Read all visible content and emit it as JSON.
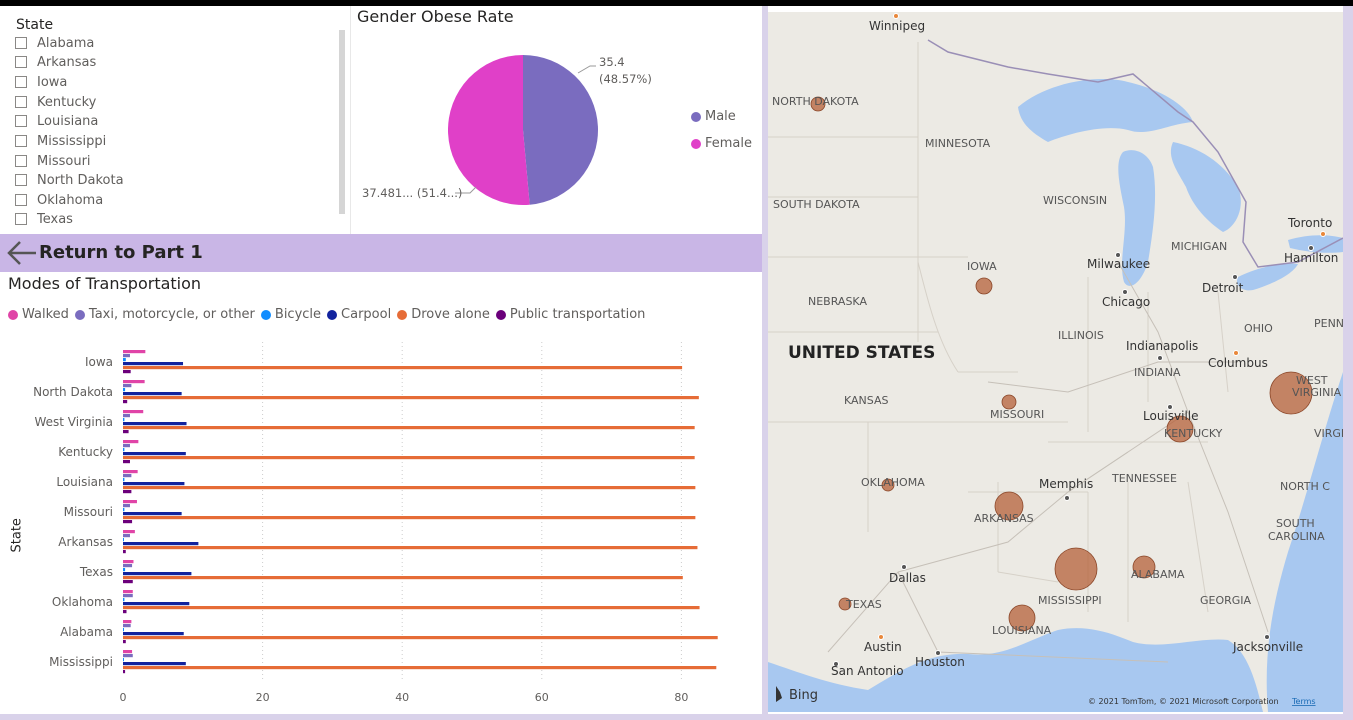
{
  "slicer": {
    "title": "State",
    "items": [
      "Alabama",
      "Arkansas",
      "Iowa",
      "Kentucky",
      "Louisiana",
      "Mississippi",
      "Missouri",
      "North Dakota",
      "Oklahoma",
      "Texas"
    ]
  },
  "pie": {
    "title": "Gender Obese Rate",
    "male_label_value": "35.4",
    "male_label_pct": "(48.57%)",
    "female_label": "37.481... (51.4...)",
    "legend": [
      {
        "name": "Male",
        "color": "#7a6cbf"
      },
      {
        "name": "Female",
        "color": "#e040c8"
      }
    ],
    "chart_data": {
      "type": "pie",
      "slices": [
        {
          "name": "Male",
          "value": 35.4,
          "pct": 48.57
        },
        {
          "name": "Female",
          "value": 37.481,
          "pct": 51.43
        }
      ]
    }
  },
  "banner": {
    "label": "Return to Part 1",
    "icon": "arrow-left-icon"
  },
  "transport": {
    "title": "Modes of Transportation",
    "ylabel": "State",
    "legend": [
      {
        "name": "Walked",
        "color": "#e044a7"
      },
      {
        "name": "Taxi, motorcycle, or other",
        "color": "#7a6cbf"
      },
      {
        "name": "Bicycle",
        "color": "#118dff"
      },
      {
        "name": "Carpool",
        "color": "#12239e"
      },
      {
        "name": "Drove alone",
        "color": "#e66c37"
      },
      {
        "name": "Public transportation",
        "color": "#6b007b"
      }
    ],
    "chart_data": {
      "type": "bar",
      "orientation": "horizontal",
      "categories": [
        "Iowa",
        "North Dakota",
        "West Virginia",
        "Kentucky",
        "Louisiana",
        "Missouri",
        "Arkansas",
        "Texas",
        "Oklahoma",
        "Alabama",
        "Mississippi"
      ],
      "xlim": [
        0,
        88
      ],
      "xticks": [
        0,
        20,
        40,
        60,
        80
      ],
      "series": [
        {
          "name": "Walked",
          "values": [
            3.2,
            3.1,
            2.9,
            2.2,
            2.1,
            2.0,
            1.7,
            1.5,
            1.4,
            1.2,
            1.3
          ]
        },
        {
          "name": "Taxi, motorcycle, or other",
          "values": [
            1.0,
            1.2,
            1.0,
            1.0,
            1.2,
            1.0,
            1.0,
            1.3,
            1.4,
            1.1,
            1.4
          ]
        },
        {
          "name": "Bicycle",
          "values": [
            0.4,
            0.3,
            0.2,
            0.2,
            0.2,
            0.2,
            0.1,
            0.3,
            0.2,
            0.1,
            0.1
          ]
        },
        {
          "name": "Carpool",
          "values": [
            8.6,
            8.4,
            9.1,
            9.0,
            8.8,
            8.4,
            10.8,
            9.8,
            9.5,
            8.7,
            9.0
          ]
        },
        {
          "name": "Drove alone",
          "values": [
            80.1,
            82.5,
            81.9,
            81.9,
            82.0,
            82.0,
            82.3,
            80.2,
            82.6,
            85.2,
            85.0
          ]
        },
        {
          "name": "Public transportation",
          "values": [
            1.1,
            0.6,
            0.8,
            1.0,
            1.2,
            1.3,
            0.4,
            1.4,
            0.5,
            0.4,
            0.3
          ]
        }
      ]
    }
  },
  "map": {
    "country_label": "UNITED STATES",
    "states": [
      {
        "name": "NORTH DAKOTA"
      },
      {
        "name": "MINNESOTA"
      },
      {
        "name": "SOUTH DAKOTA"
      },
      {
        "name": "WISCONSIN"
      },
      {
        "name": "MICHIGAN"
      },
      {
        "name": "IOWA"
      },
      {
        "name": "NEBRASKA"
      },
      {
        "name": "ILLINOIS"
      },
      {
        "name": "INDIANA"
      },
      {
        "name": "OHIO"
      },
      {
        "name": "PENN"
      },
      {
        "name": "KANSAS"
      },
      {
        "name": "MISSOURI"
      },
      {
        "name": "KENTUCKY"
      },
      {
        "name": "WEST VIRGINIA"
      },
      {
        "name": "VIRGI"
      },
      {
        "name": "OKLAHOMA"
      },
      {
        "name": "TENNESSEE"
      },
      {
        "name": "NORTH C"
      },
      {
        "name": "ARKANSAS"
      },
      {
        "name": "SOUTH CAROLINA"
      },
      {
        "name": "ALABAMA"
      },
      {
        "name": "MISSISSIPPI"
      },
      {
        "name": "GEORGIA"
      },
      {
        "name": "TEXAS"
      },
      {
        "name": "LOUISIANA"
      }
    ],
    "cities": [
      "Winnipeg",
      "Toronto",
      "Hamilton",
      "Milwaukee",
      "Chicago",
      "Detroit",
      "Indianapolis",
      "Columbus",
      "Louisville",
      "Memphis",
      "Dallas",
      "Austin",
      "San Antonio",
      "Houston",
      "Jacksonville"
    ],
    "attribution": "© 2021 TomTom, © 2021 Microsoft Corporation",
    "terms": "Terms",
    "bing": "Bing",
    "bubble_color": "#b5603a"
  }
}
